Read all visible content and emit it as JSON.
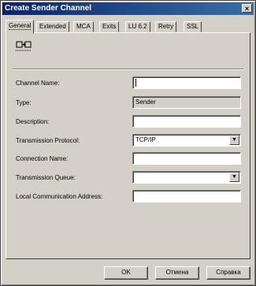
{
  "window": {
    "title": "Create Sender Channel",
    "close_glyph": "×"
  },
  "tabs": [
    "General",
    "Extended",
    "MCA",
    "Exits",
    "LU 6.2",
    "Retry",
    "SSL"
  ],
  "active_tab": "General",
  "form": {
    "fields": [
      {
        "label": "Channel Name:",
        "value": "",
        "kind": "text"
      },
      {
        "label": "Type:",
        "value": "Sender",
        "kind": "readonly"
      },
      {
        "label": "Description:",
        "value": "",
        "kind": "text"
      },
      {
        "label": "Transmission Protocol:",
        "value": "TCP/IP",
        "kind": "combo"
      },
      {
        "label": "Connection Name:",
        "value": "",
        "kind": "text"
      },
      {
        "label": "Transmission Queue:",
        "value": "",
        "kind": "combo"
      },
      {
        "label": "Local Communication Address:",
        "value": "",
        "kind": "text"
      }
    ]
  },
  "buttons": {
    "ok": "OK",
    "cancel": "Отмена",
    "help": "Справка"
  },
  "icons": {
    "panel": "channel-icon",
    "dropdown": "chevron-down-icon",
    "close": "close-icon"
  },
  "colors": {
    "titlebar_start": "#0a246a",
    "titlebar_end": "#3a6ea5",
    "face": "#d4d0c8"
  }
}
